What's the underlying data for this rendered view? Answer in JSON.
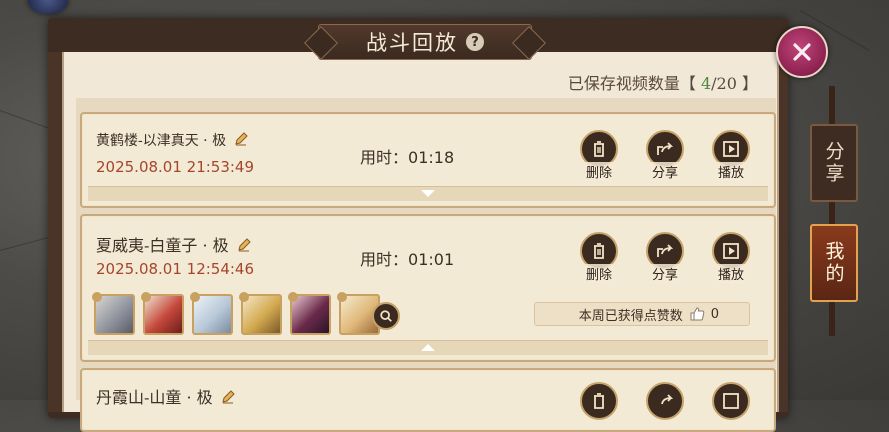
{
  "header": {
    "title": "战斗回放",
    "help_symbol": "?",
    "close_symbol": "×"
  },
  "saved": {
    "label": "已保存视频数量",
    "bracket_open": "【",
    "current": "4",
    "separator": "/",
    "max": "20",
    "bracket_close": "】"
  },
  "duration_label": "用时：",
  "actions": {
    "delete": "删除",
    "share": "分享",
    "play": "播放"
  },
  "entries": [
    {
      "name": "黄鹤楼-以津真天 · 极",
      "date": "2025.08.01 21:53:49",
      "duration": "01:18",
      "expanded": false
    },
    {
      "name": "夏威夷-白童子 · 极",
      "date": "2025.08.01 12:54:46",
      "duration": "01:01",
      "expanded": true,
      "likes_label": "本周已获得点赞数",
      "likes": "0"
    },
    {
      "name": "丹霞山-山童 · 极",
      "date": "",
      "duration": "",
      "expanded": false
    }
  ],
  "side_tabs": [
    {
      "label": "分享",
      "active": false
    },
    {
      "label": "我的",
      "active": true
    }
  ],
  "colors": {
    "accent_red": "#a6452c",
    "count_green": "#4c8a3e",
    "close_pink": "#8d2150",
    "panel_brown": "#3d2c22"
  }
}
